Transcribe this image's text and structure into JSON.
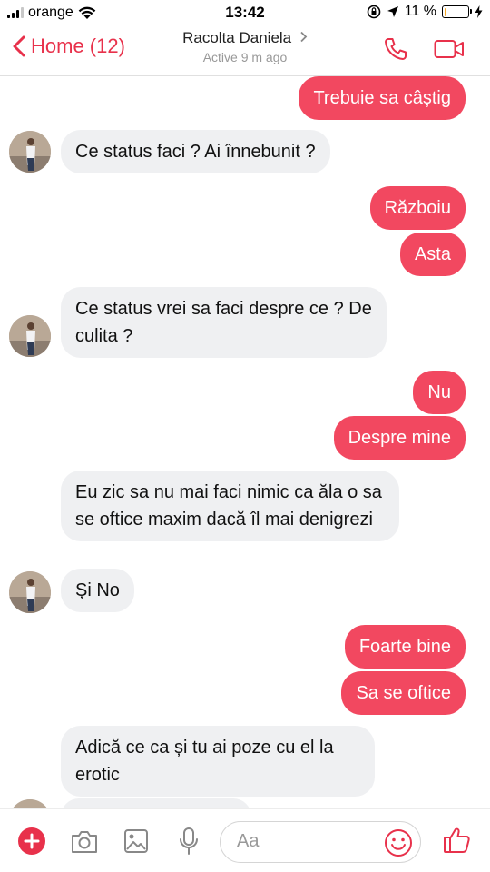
{
  "status_bar": {
    "carrier": "orange",
    "time": "13:42",
    "battery_text": "11 %",
    "battery_level": 0.11
  },
  "header": {
    "back_label": "Home (12)",
    "contact_name": "Racolta Daniela",
    "active_status": "Active 9 m ago",
    "accent_color": "#e8314b"
  },
  "messages": [
    {
      "side": "out",
      "text": "Trebuie sa câștig"
    },
    {
      "side": "in",
      "text": "Ce status faci ? Ai înnebunit ?"
    },
    {
      "side": "out",
      "text": "Războiu"
    },
    {
      "side": "out",
      "text": "Asta"
    },
    {
      "side": "in",
      "text": "Ce status vrei sa faci despre ce ? De culita ?"
    },
    {
      "side": "out",
      "text": "Nu"
    },
    {
      "side": "out",
      "text": "Despre mine"
    },
    {
      "side": "in",
      "text": "Eu zic sa nu mai faci nimic ca ăla o sa se oftice maxim dacă îl mai denigrezi"
    },
    {
      "side": "in",
      "text": "Și No"
    },
    {
      "side": "out",
      "text": "Foarte bine"
    },
    {
      "side": "out",
      "text": "Sa se oftice"
    },
    {
      "side": "in",
      "text": "Adică ce ca și tu ai poze cu el la erotic"
    }
  ],
  "composer": {
    "placeholder": "Aa",
    "icons": [
      "plus-icon",
      "camera-icon",
      "gallery-icon",
      "microphone-icon",
      "emoji-icon",
      "thumbs-up-icon"
    ]
  }
}
